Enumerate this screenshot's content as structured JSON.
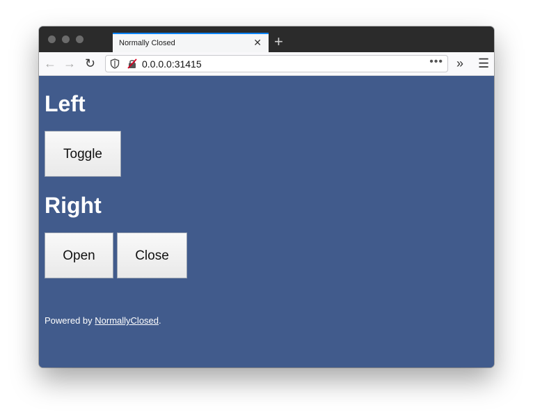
{
  "browser": {
    "tab_title": "Normally Closed",
    "url": "0.0.0.0:31415"
  },
  "page": {
    "left_heading": "Left",
    "toggle_label": "Toggle",
    "right_heading": "Right",
    "open_label": "Open",
    "close_label": "Close",
    "footer_prefix": "Powered by ",
    "footer_link": "NormallyClosed",
    "footer_suffix": "."
  },
  "colors": {
    "page_background": "#415b8c",
    "titlebar": "#2b2b2b",
    "tab_accent": "#0a84ff"
  }
}
